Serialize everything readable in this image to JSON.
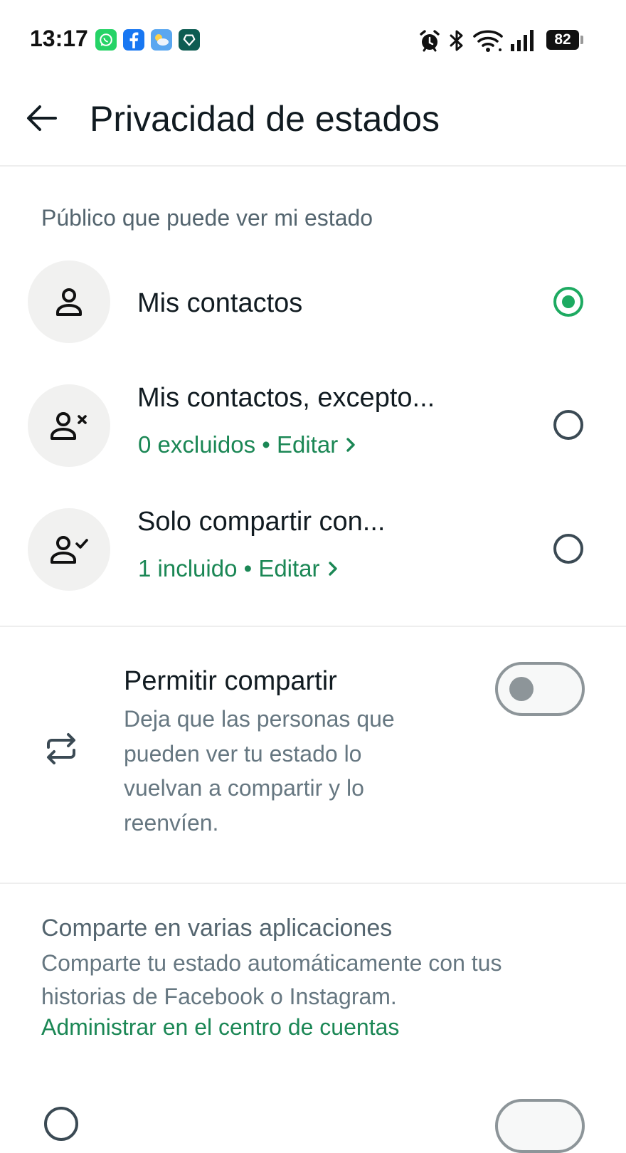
{
  "status_bar": {
    "time": "13:17",
    "battery": "82",
    "notification_icons": [
      "whatsapp-icon",
      "facebook-icon",
      "weather-icon",
      "app-icon"
    ],
    "system_icons": [
      "alarm-icon",
      "bluetooth-icon",
      "wifi-icon",
      "signal-icon",
      "battery-icon"
    ]
  },
  "header": {
    "title": "Privacidad de estados"
  },
  "audience": {
    "label": "Público que puede ver mi estado",
    "options": [
      {
        "title": "Mis contactos",
        "subtitle": "",
        "selected": true,
        "icon": "person-icon"
      },
      {
        "title": "Mis contactos, excepto...",
        "subtitle": "0 excluidos • Editar",
        "selected": false,
        "icon": "person-remove-icon"
      },
      {
        "title": "Solo compartir con...",
        "subtitle": "1 incluido • Editar",
        "selected": false,
        "icon": "person-check-icon"
      }
    ]
  },
  "allow_sharing": {
    "title": "Permitir compartir",
    "description": "Deja que las personas que pueden ver tu estado lo vuelvan a compartir y lo reenvíen.",
    "enabled": false,
    "icon": "repeat-icon"
  },
  "cross_app": {
    "title": "Comparte en varias aplicaciones",
    "description": "Comparte tu estado automáticamente con tus historias de Facebook o Instagram.",
    "link": "Administrar en el centro de cuentas"
  },
  "colors": {
    "accent": "#1daa61",
    "link": "#1b8755",
    "text_primary": "#111b21",
    "text_secondary": "#667781"
  }
}
